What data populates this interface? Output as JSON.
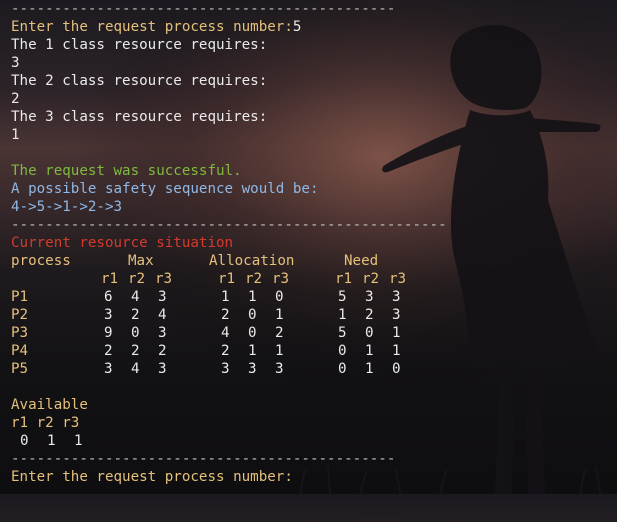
{
  "separator_top": "---------------------------------------------",
  "prompt1": {
    "label": "Enter the request process number:",
    "value": "5"
  },
  "requires": [
    {
      "label": "The 1 class resource requires:",
      "value": "3"
    },
    {
      "label": "The 2 class resource requires:",
      "value": "2"
    },
    {
      "label": "The 3 class resource requires:",
      "value": "1"
    }
  ],
  "success_msg": "The request was successful.",
  "safety_label": "A possible safety sequence would be:",
  "safety_sequence": "4->5->1->2->3",
  "separator_mid": "---------------------------------------------------",
  "situation_title": "Current resource situation",
  "table": {
    "headers": {
      "process": "process",
      "max": "Max",
      "allocation": "Allocation",
      "need": "Need"
    },
    "subheaders": {
      "r1": "r1",
      "r2": "r2",
      "r3": "r3"
    },
    "rows": [
      {
        "process": "P1",
        "max": [
          "6",
          "4",
          "3"
        ],
        "allocation": [
          "1",
          "1",
          "0"
        ],
        "need": [
          "5",
          "3",
          "3"
        ]
      },
      {
        "process": "P2",
        "max": [
          "3",
          "2",
          "4"
        ],
        "allocation": [
          "2",
          "0",
          "1"
        ],
        "need": [
          "1",
          "2",
          "3"
        ]
      },
      {
        "process": "P3",
        "max": [
          "9",
          "0",
          "3"
        ],
        "allocation": [
          "4",
          "0",
          "2"
        ],
        "need": [
          "5",
          "0",
          "1"
        ]
      },
      {
        "process": "P4",
        "max": [
          "2",
          "2",
          "2"
        ],
        "allocation": [
          "2",
          "1",
          "1"
        ],
        "need": [
          "0",
          "1",
          "1"
        ]
      },
      {
        "process": "P5",
        "max": [
          "3",
          "4",
          "3"
        ],
        "allocation": [
          "3",
          "3",
          "3"
        ],
        "need": [
          "0",
          "1",
          "0"
        ]
      }
    ]
  },
  "available": {
    "label": "Available",
    "subheader": "r1 r2 r3",
    "values": [
      "0",
      "1",
      "1"
    ]
  },
  "separator_bottom": "---------------------------------------------",
  "prompt2": {
    "label": "Enter the request process number:"
  },
  "colors": {
    "yellow": "#e5c07b",
    "green": "#7fba3f",
    "blue": "#8fb8e6",
    "red": "#d23b2e",
    "text": "#eaeaea"
  }
}
